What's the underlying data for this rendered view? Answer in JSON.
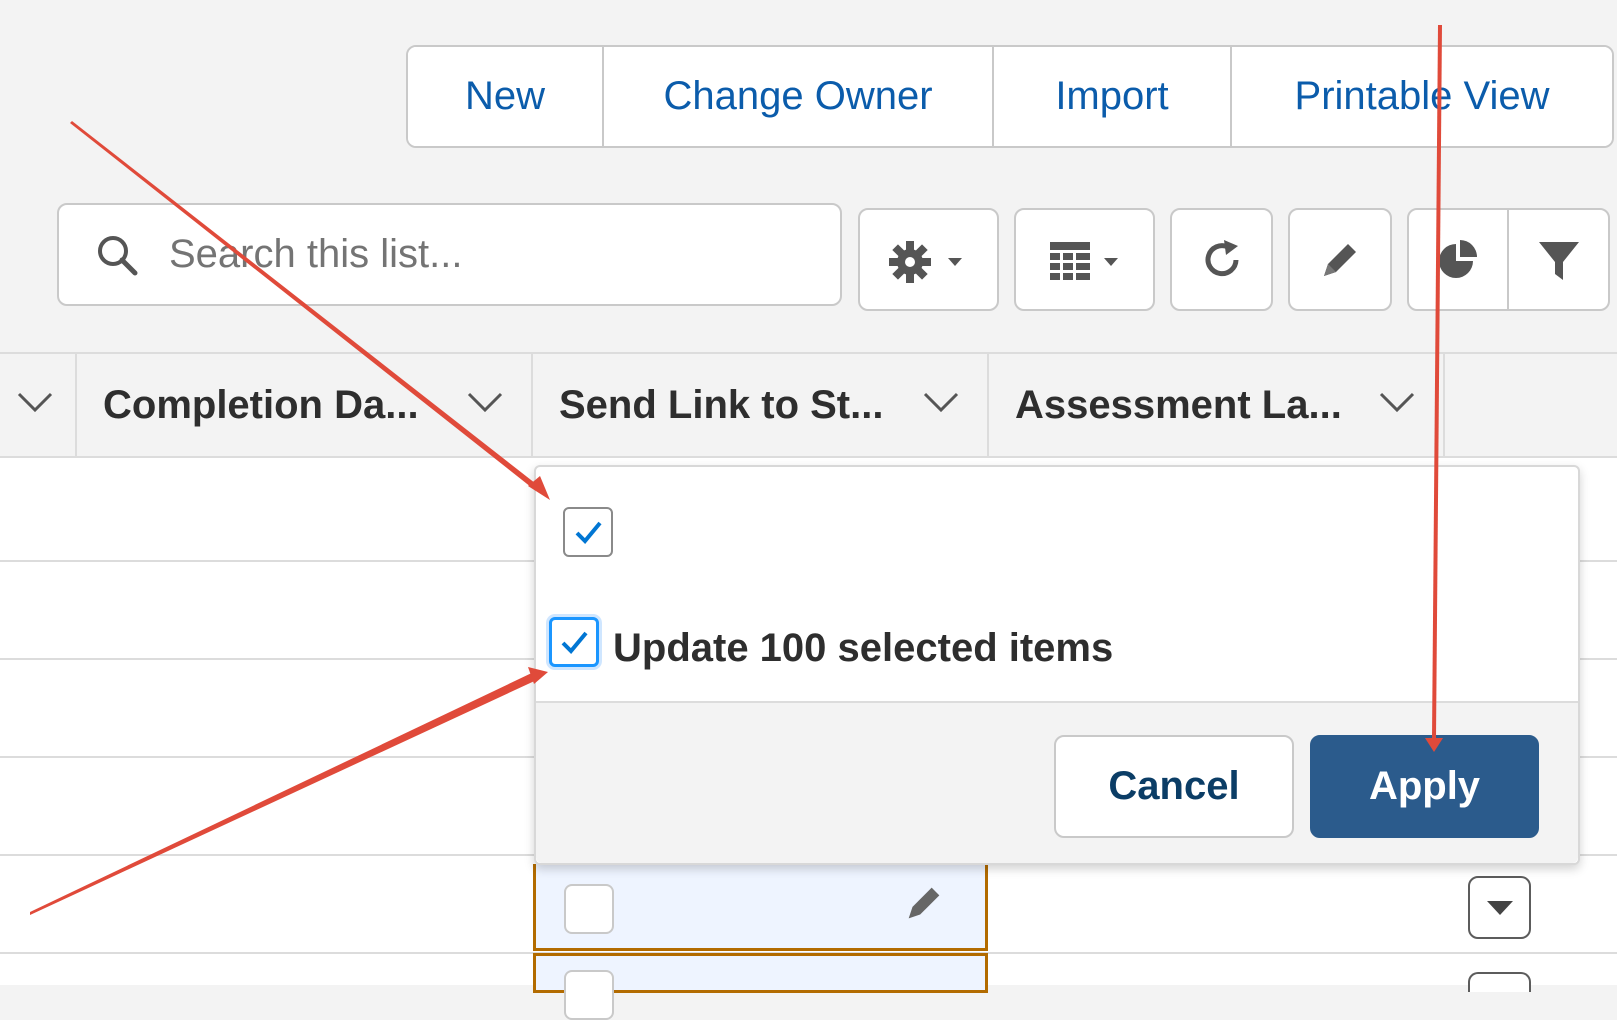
{
  "toolbar": {
    "actions": [
      "New",
      "Change Owner",
      "Import",
      "Printable View"
    ]
  },
  "search": {
    "placeholder": "Search this list..."
  },
  "list_controls": [
    "settings-icon",
    "display-as-table-icon",
    "refresh-icon",
    "edit-list-icon",
    "charts-icon",
    "filter-icon"
  ],
  "table": {
    "columns": [
      "Completion Da...",
      "Send Link to St...",
      "Assessment La..."
    ]
  },
  "popover": {
    "field_value_checked": true,
    "bulk_update_checked": true,
    "bulk_update_label": "Update 100 selected items",
    "cancel_label": "Cancel",
    "apply_label": "Apply"
  },
  "colors": {
    "brand_blue": "#0b5cab",
    "apply_bg": "#2b5b8c",
    "annotation_red": "#e04a3a",
    "edit_border": "#b26b00"
  }
}
